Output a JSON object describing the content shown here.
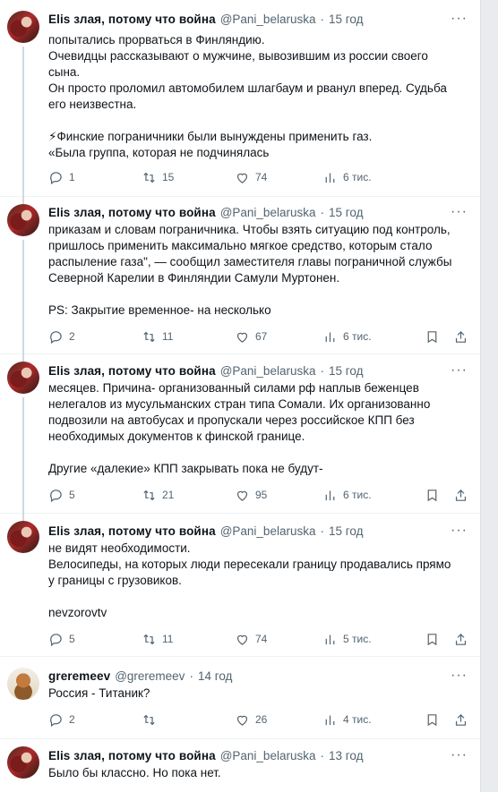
{
  "tweets": [
    {
      "name": "Elis злая, потому что война",
      "handle": "@Pani_belaruska",
      "time": "15 год",
      "lines": [
        "попытались прорваться в Финляндию.",
        "Очевидцы рассказывают о мужчине, вывозившим из россии своего",
        "сына.",
        "Он просто проломил автомобилем  шлагбаум и рванул вперед. Судьба",
        "его неизвестна.",
        "",
        "⚡Финские пограничники были вынуждены  применить газ.",
        "«Была группа, которая не подчинялась"
      ],
      "replies": "1",
      "retweets": "15",
      "likes": "74",
      "views": "6 тис."
    },
    {
      "name": "Elis злая, потому что война",
      "handle": "@Pani_belaruska",
      "time": "15 год",
      "lines": [
        "приказам и словам пограничника. Чтобы взять ситуацию под контроль,",
        "пришлось применить максимально мягкое средство, которым стало",
        "распыление газа\", — сообщил заместителя главы пограничной службы",
        "Северной Карелии в Финляндии Самули Муртонен.",
        "",
        "PS: Закрытие временное- на несколько"
      ],
      "replies": "2",
      "retweets": "11",
      "likes": "67",
      "views": "6 тис."
    },
    {
      "name": "Elis злая, потому что война",
      "handle": "@Pani_belaruska",
      "time": "15 год",
      "lines": [
        "месяцев. Причина- организованный силами рф наплыв беженцев",
        "нелегалов из  мусульманских стран типа Сомали.  Их организованно",
        "подвозили на автобусах и пропускали через российское КПП без",
        "необходимых документов к финской границе.",
        "",
        "Другие «далекие» КПП  закрывать пока  не будут-"
      ],
      "replies": "5",
      "retweets": "21",
      "likes": "95",
      "views": "6 тис."
    },
    {
      "name": "Elis злая, потому что война",
      "handle": "@Pani_belaruska",
      "time": "15 год",
      "lines": [
        "не видят необходимости.",
        "Велосипеды, на которых люди пересекали границу продавались прямо",
        "у границы с грузовиков.",
        "",
        "nevzorovtv"
      ],
      "replies": "5",
      "retweets": "11",
      "likes": "74",
      "views": "5 тис."
    },
    {
      "name": "greremeev",
      "handle": "@greremeev",
      "time": "14 год",
      "lines": [
        "Россия - Титаник?"
      ],
      "replies": "2",
      "retweets": "",
      "likes": "26",
      "views": "4 тис."
    },
    {
      "name": "Elis злая, потому что война",
      "handle": "@Pani_belaruska",
      "time": "13 год",
      "lines": [
        "Было бы классно. Но пока нет."
      ],
      "replies": "",
      "retweets": "",
      "likes": "",
      "views": ""
    }
  ],
  "separator": "·"
}
